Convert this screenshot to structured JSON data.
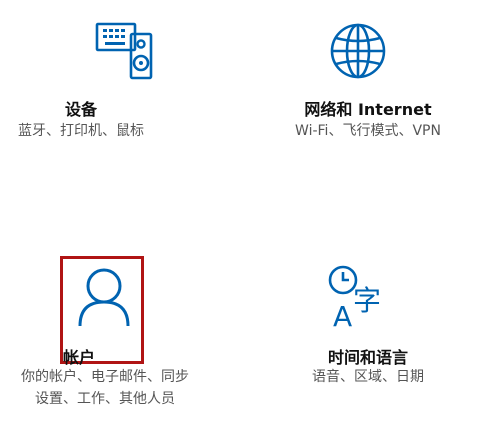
{
  "tiles": {
    "devices": {
      "title": "设备",
      "desc": "蓝牙、打印机、鼠标",
      "icon": "devices-icon"
    },
    "network": {
      "title": "网络和 Internet",
      "desc": "Wi-Fi、飞行模式、VPN",
      "icon": "globe-icon"
    },
    "accounts": {
      "title": "帐户",
      "desc_line1": "你的帐户、电子邮件、同步",
      "desc_line2": "设置、工作、其他人员",
      "icon": "person-icon"
    },
    "time": {
      "title": "时间和语言",
      "desc": "语音、区域、日期",
      "icon": "time-language-icon",
      "glyph": "字",
      "glyph_a": "A"
    }
  },
  "colors": {
    "icon": "#0063b1",
    "highlight": "#b01414"
  }
}
